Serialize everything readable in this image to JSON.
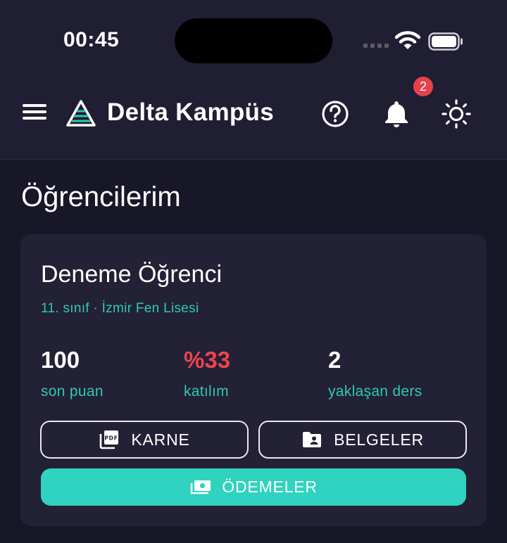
{
  "status_bar": {
    "time": "00:45"
  },
  "header": {
    "app_title": "Delta Kampüs",
    "notification_count": "2",
    "icons": [
      "menu-icon",
      "delta-logo-icon",
      "help-icon",
      "bell-icon",
      "sun-icon"
    ]
  },
  "page": {
    "title": "Öğrencilerim"
  },
  "student": {
    "name": "Deneme Öğrenci",
    "meta": "11. sınıf · İzmir Fen Lisesi",
    "stats": [
      {
        "value": "100",
        "label": "son puan"
      },
      {
        "value": "%33",
        "label": "katılım"
      },
      {
        "value": "2",
        "label": "yaklaşan ders"
      }
    ],
    "buttons": {
      "karne": "KARNE",
      "belgeler": "BELGELER",
      "odemeler": "ÖDEMELER"
    }
  },
  "colors": {
    "background": "#181727",
    "header": "#201e33",
    "card": "#232135",
    "accent": "#2fd3bf",
    "danger": "#f0434e"
  }
}
